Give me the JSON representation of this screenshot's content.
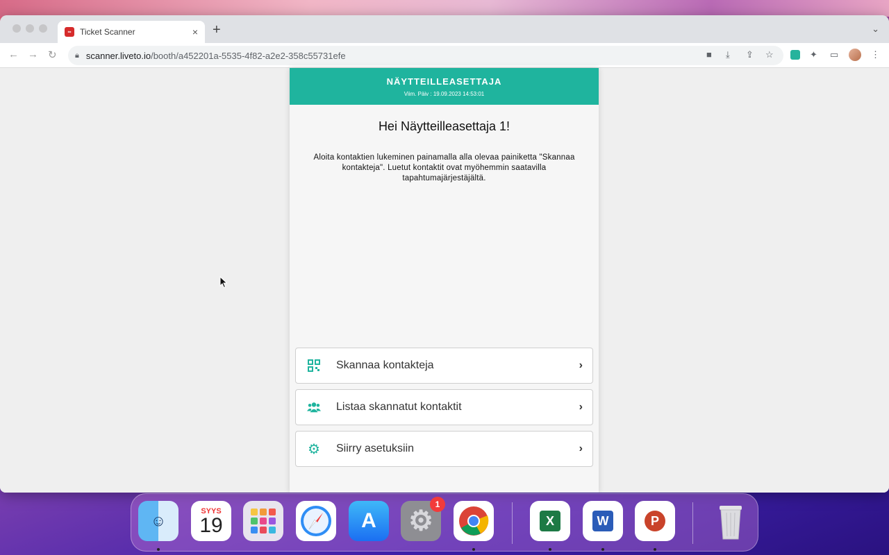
{
  "browser": {
    "tab_title": "Ticket Scanner",
    "tab_close": "×",
    "new_tab": "+",
    "url_domain": "scanner.liveto.io",
    "url_path": "/booth/a452201a-5535-4f82-a2e2-358c55731efe"
  },
  "header": {
    "role": "NÄYTTEILLEASETTAJA",
    "updated": "Viim. Päiv : 19.09.2023 14:53:01"
  },
  "main": {
    "greeting": "Hei Näytteilleasettaja 1!",
    "intro": "Aloita kontaktien lukeminen painamalla alla olevaa painiketta \"Skannaa kontakteja\". Luetut kontaktit ovat myöhemmin saatavilla tapahtumajärjestäjältä."
  },
  "actions": [
    {
      "label": "Skannaa kontakteja",
      "icon": "qr-code-icon"
    },
    {
      "label": "Listaa skannatut kontaktit",
      "icon": "users-icon"
    },
    {
      "label": "Siirry asetuksiin",
      "icon": "gear-icon"
    }
  ],
  "dock": {
    "calendar_month": "SYYS",
    "calendar_day": "19",
    "settings_badge": "1"
  },
  "colors": {
    "accent": "#1fb49e"
  }
}
